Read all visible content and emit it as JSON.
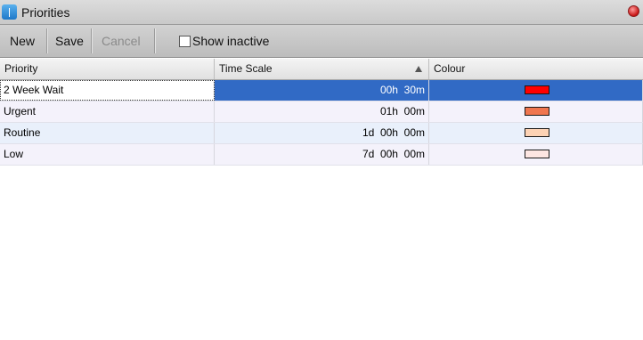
{
  "window": {
    "title": "Priorities"
  },
  "toolbar": {
    "new_label": "New",
    "save_label": "Save",
    "cancel_label": "Cancel",
    "show_inactive_label": "Show inactive",
    "show_inactive_checked": false
  },
  "table": {
    "columns": [
      "Priority",
      "Time Scale",
      "Colour"
    ],
    "sort_column": "Time Scale",
    "sort_direction": "ascending",
    "rows": [
      {
        "priority": "2 Week Wait",
        "time_scale": "00h  30m",
        "colour": "#ff0000",
        "selected": true
      },
      {
        "priority": "Urgent",
        "time_scale": "01h  00m",
        "colour": "#f0764f",
        "selected": false
      },
      {
        "priority": "Routine",
        "time_scale": "1d  00h  00m",
        "colour": "#fcd2b4",
        "selected": false
      },
      {
        "priority": "Low",
        "time_scale": "7d  00h  00m",
        "colour": "#fde6e2",
        "selected": false
      }
    ]
  },
  "colors": {
    "selection": "#316ac5",
    "row_bg_a": "#e9f0fb",
    "row_bg_b": "#f4f2fb"
  }
}
